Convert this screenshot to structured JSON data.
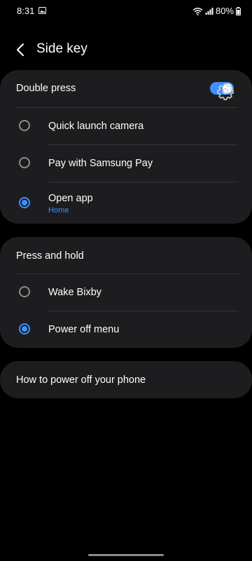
{
  "status_bar": {
    "time": "8:31",
    "battery": "80%"
  },
  "header": {
    "title": "Side key"
  },
  "double_press": {
    "label": "Double press",
    "enabled": true,
    "options": [
      {
        "label": "Quick launch camera",
        "selected": false
      },
      {
        "label": "Pay with Samsung Pay",
        "selected": false
      },
      {
        "label": "Open app",
        "sublabel": "Home",
        "selected": true
      }
    ]
  },
  "press_and_hold": {
    "label": "Press and hold",
    "options": [
      {
        "label": "Wake Bixby",
        "selected": false
      },
      {
        "label": "Power off menu",
        "selected": true
      }
    ]
  },
  "help": {
    "label": "How to power off your phone"
  },
  "colors": {
    "background": "#000000",
    "card": "#1d1d1f",
    "accent": "#3e91ff",
    "divider": "#343436"
  },
  "icons": {
    "back": "chevron-left-icon",
    "settings": "gear-icon",
    "wifi": "wifi-icon",
    "signal": "signal-icon",
    "battery": "battery-icon",
    "photo": "photo-icon"
  }
}
